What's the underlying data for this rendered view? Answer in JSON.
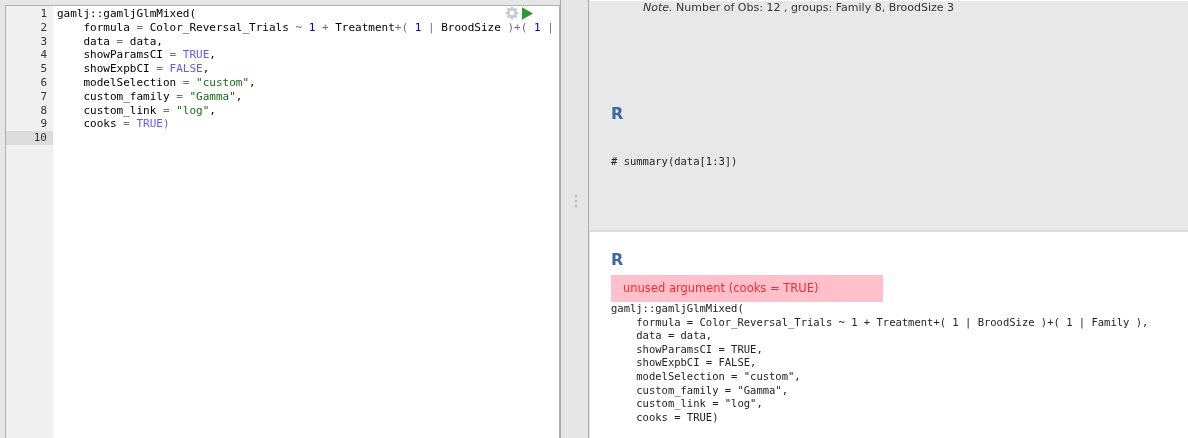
{
  "editor": {
    "lines": [
      {
        "number": "1",
        "selected": false,
        "tokens": [
          {
            "kind": "text",
            "text": "gamlj::gamljGlmMixed("
          }
        ]
      },
      {
        "number": "2",
        "selected": false,
        "tokens": [
          {
            "kind": "text",
            "text": "    formula "
          },
          {
            "kind": "op",
            "text": "= "
          },
          {
            "kind": "text",
            "text": "Color_Reversal_Trials "
          },
          {
            "kind": "op",
            "text": "~ "
          },
          {
            "kind": "number",
            "text": "1"
          },
          {
            "kind": "op",
            "text": " + "
          },
          {
            "kind": "text",
            "text": "Treatment"
          },
          {
            "kind": "op",
            "text": "+( "
          },
          {
            "kind": "number",
            "text": "1"
          },
          {
            "kind": "op",
            "text": " | "
          },
          {
            "kind": "text",
            "text": "BroodSize "
          },
          {
            "kind": "op",
            "text": ")+( "
          },
          {
            "kind": "number",
            "text": "1"
          },
          {
            "kind": "op",
            "text": " |"
          }
        ]
      },
      {
        "number": "3",
        "selected": false,
        "tokens": [
          {
            "kind": "text",
            "text": "    data "
          },
          {
            "kind": "op",
            "text": "= "
          },
          {
            "kind": "text",
            "text": "data,"
          }
        ]
      },
      {
        "number": "4",
        "selected": false,
        "tokens": [
          {
            "kind": "text",
            "text": "    showParamsCI "
          },
          {
            "kind": "op",
            "text": "= "
          },
          {
            "kind": "constant",
            "text": "TRUE"
          },
          {
            "kind": "text",
            "text": ","
          }
        ]
      },
      {
        "number": "5",
        "selected": false,
        "tokens": [
          {
            "kind": "text",
            "text": "    showExpbCI "
          },
          {
            "kind": "op",
            "text": "= "
          },
          {
            "kind": "constant",
            "text": "FALSE"
          },
          {
            "kind": "text",
            "text": ","
          }
        ]
      },
      {
        "number": "6",
        "selected": false,
        "tokens": [
          {
            "kind": "text",
            "text": "    modelSelection "
          },
          {
            "kind": "op",
            "text": "= "
          },
          {
            "kind": "string",
            "text": "\"custom\""
          },
          {
            "kind": "text",
            "text": ","
          }
        ]
      },
      {
        "number": "7",
        "selected": false,
        "tokens": [
          {
            "kind": "text",
            "text": "    custom_family "
          },
          {
            "kind": "op",
            "text": "= "
          },
          {
            "kind": "string",
            "text": "\"Gamma\""
          },
          {
            "kind": "text",
            "text": ","
          }
        ]
      },
      {
        "number": "8",
        "selected": false,
        "tokens": [
          {
            "kind": "text",
            "text": "    custom_link "
          },
          {
            "kind": "op",
            "text": "= "
          },
          {
            "kind": "string",
            "text": "\"log\""
          },
          {
            "kind": "text",
            "text": ","
          }
        ]
      },
      {
        "number": "9",
        "selected": false,
        "tokens": [
          {
            "kind": "text",
            "text": "    cooks "
          },
          {
            "kind": "op",
            "text": "= "
          },
          {
            "kind": "constant",
            "text": "TRUE"
          },
          {
            "kind": "op",
            "text": ")"
          }
        ]
      },
      {
        "number": "10",
        "selected": true
      }
    ]
  },
  "results": {
    "note": "*Note.* Number of Obs: 12 , groups: Family 8, BroodSize 3",
    "blocks": [
      {
        "heading": "R",
        "active": false,
        "code": [
          "# summary(data[1:3])"
        ]
      },
      {
        "heading": "R",
        "active": true,
        "error": "unused argument (cooks = TRUE)",
        "code": [
          "gamlj::gamljGlmMixed(",
          "    formula = Color_Reversal_Trials ~ 1 + Treatment+( 1 | BroodSize )+( 1 | Family ),",
          "    data = data,",
          "    showParamsCI = TRUE,",
          "    showExpbCI = FALSE,",
          "    modelSelection = \"custom\",",
          "    custom_family = \"Gamma\",",
          "    custom_link = \"log\",",
          "    cooks = TRUE)"
        ]
      }
    ]
  }
}
